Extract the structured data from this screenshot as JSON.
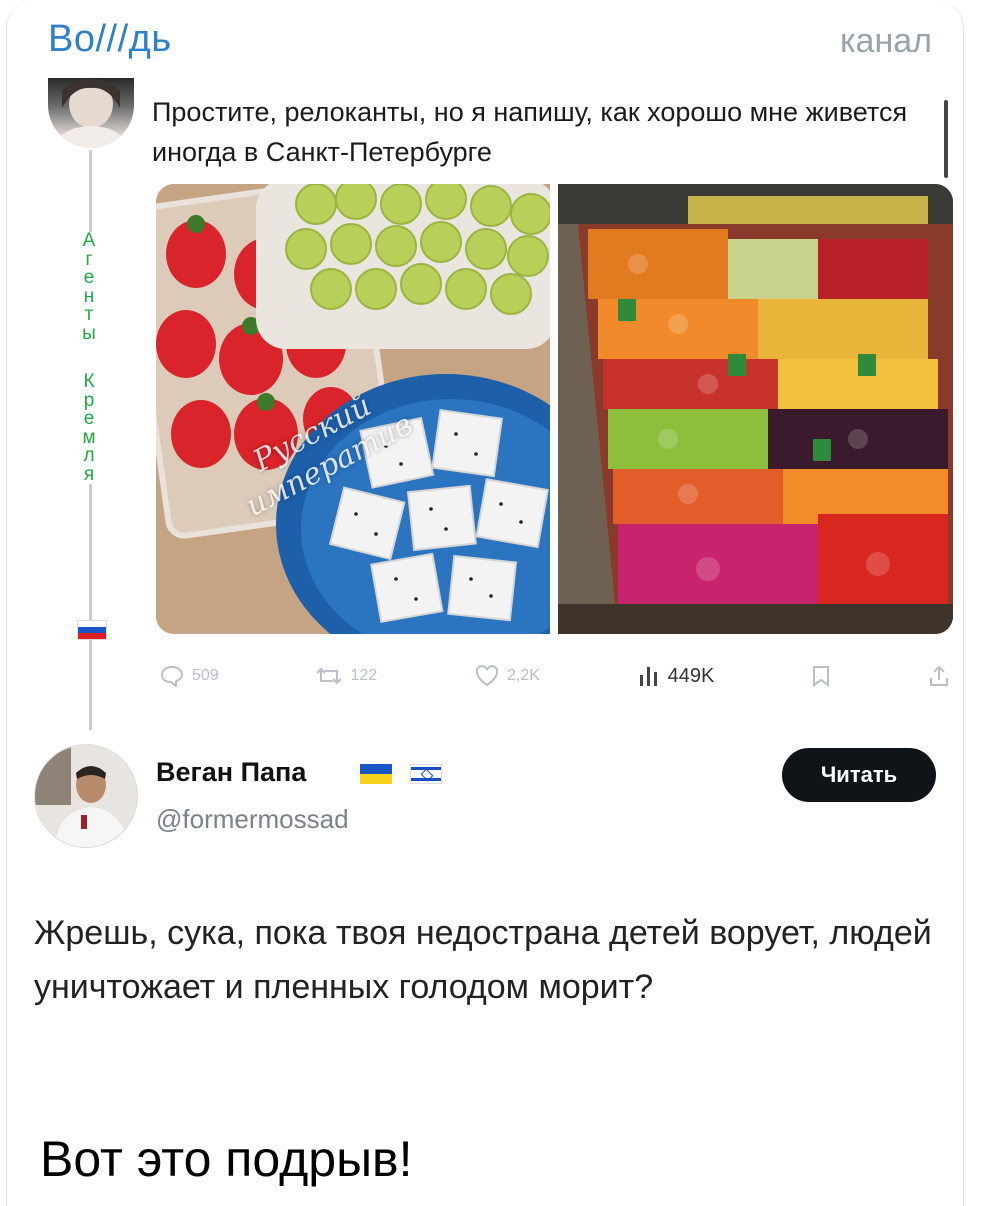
{
  "header": {
    "channel_name": "Во///дь",
    "channel_tag": "канал"
  },
  "side_text": [
    "А",
    "г",
    "е",
    "н",
    "т",
    "ы",
    "",
    "К",
    "р",
    "е",
    "м",
    "л",
    "я"
  ],
  "original_post": {
    "text": "Простите, релоканты, но я напишу, как хорошо мне живется иногда в Санкт-Петербурге",
    "watermark": "Русский императив",
    "stats": {
      "replies": "509",
      "reposts": "122",
      "likes": "2,2K",
      "views": "449K"
    }
  },
  "reply": {
    "name": "Веган Папа",
    "handle": "@formermossad",
    "follow_label": "Читать",
    "text": "Жрешь, сука, пока твоя недострана детей ворует, людей уничтожает и пленных голодом морит?"
  },
  "caption": "Вот это подрыв!",
  "colors": {
    "channel_accent": "#2f80c8",
    "side_text": "#22a845",
    "button_bg": "#0f1419"
  }
}
